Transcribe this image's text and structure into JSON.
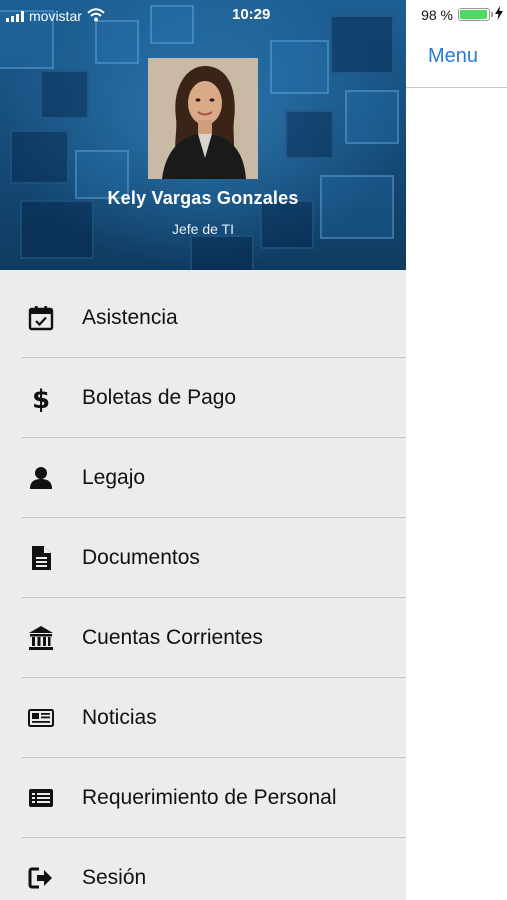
{
  "status_bar": {
    "carrier": "movistar",
    "time": "10:29",
    "battery_percent": "98 %",
    "battery_level": 0.98
  },
  "navbar": {
    "menu_label": "Menu",
    "accent": "#2a7bd1"
  },
  "profile": {
    "name": "Kely Vargas Gonzales",
    "role": "Jefe de TI"
  },
  "menu": {
    "items": [
      {
        "label": "Asistencia",
        "icon": "calendar-check-icon"
      },
      {
        "label": "Boletas de Pago",
        "icon": "dollar-icon"
      },
      {
        "label": "Legajo",
        "icon": "user-icon"
      },
      {
        "label": "Documentos",
        "icon": "document-icon"
      },
      {
        "label": "Cuentas Corrientes",
        "icon": "bank-icon"
      },
      {
        "label": "Noticias",
        "icon": "newspaper-icon"
      },
      {
        "label": "Requerimiento de Personal",
        "icon": "list-card-icon"
      },
      {
        "label": "Sesión",
        "icon": "sign-out-icon"
      }
    ]
  }
}
